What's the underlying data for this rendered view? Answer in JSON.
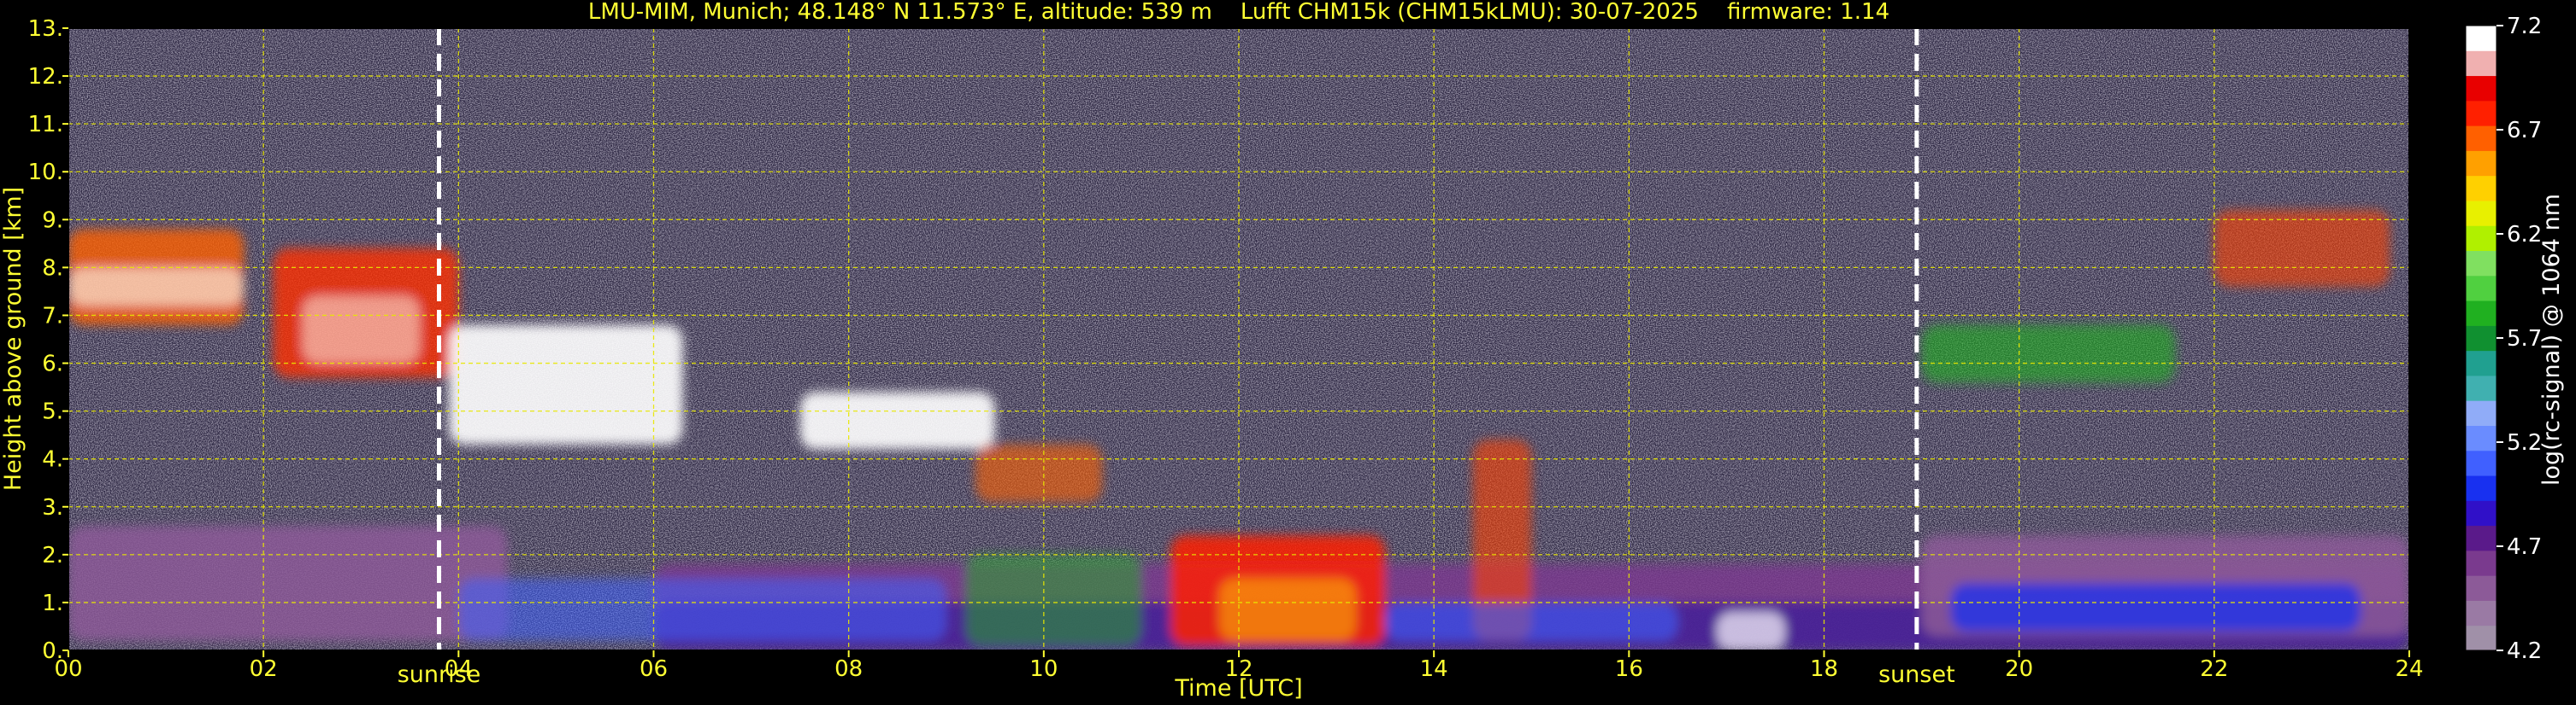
{
  "chart_data": {
    "type": "heatmap",
    "title": "LMU-MIM, Munich; 48.148° N 11.573° E, altitude: 539 m    Lufft CHM15k (CHM15kLMU): 30-07-2025    firmware: 1.14",
    "xlabel": "Time [UTC]",
    "ylabel": "Height above ground [km]",
    "xlim": [
      0,
      24
    ],
    "ylim": [
      0,
      13
    ],
    "x_ticks": [
      0,
      2,
      4,
      6,
      8,
      10,
      12,
      14,
      16,
      18,
      20,
      22,
      24
    ],
    "x_tick_labels": [
      "00",
      "02",
      "04",
      "06",
      "08",
      "10",
      "12",
      "14",
      "16",
      "18",
      "20",
      "22",
      "24"
    ],
    "y_ticks": [
      0,
      1,
      2,
      3,
      4,
      5,
      6,
      7,
      8,
      9,
      10,
      11,
      12,
      13
    ],
    "y_tick_labels": [
      "0.",
      "1.",
      "2.",
      "3.",
      "4.",
      "5.",
      "6.",
      "7.",
      "8.",
      "9.",
      "10.",
      "11.",
      "12.",
      "13."
    ],
    "grid": true,
    "colorbar": {
      "label": "log(rc-signal) @ 1064 nm",
      "range": [
        4.2,
        7.2
      ],
      "ticks": [
        4.2,
        4.7,
        5.2,
        5.7,
        6.2,
        6.7,
        7.2
      ],
      "tick_labels": [
        "4.2",
        "4.7",
        "5.2",
        "5.7",
        "6.2",
        "6.7",
        "7.2"
      ],
      "colors": [
        "#a090a8",
        "#9a7aa4",
        "#8c5a98",
        "#7a3a8e",
        "#5a1a8a",
        "#3010c8",
        "#1830f0",
        "#4060ff",
        "#6a8cff",
        "#90acf8",
        "#40b0b0",
        "#20a090",
        "#109030",
        "#20b020",
        "#50d040",
        "#80e060",
        "#b0f000",
        "#e8f000",
        "#ffd000",
        "#ffa000",
        "#ff6000",
        "#ff2000",
        "#e80000",
        "#f0b0b0",
        "#ffffff"
      ]
    },
    "annotations": [
      {
        "label": "sunrise",
        "x": 3.8
      },
      {
        "label": "sunset",
        "x": 18.95
      }
    ]
  }
}
